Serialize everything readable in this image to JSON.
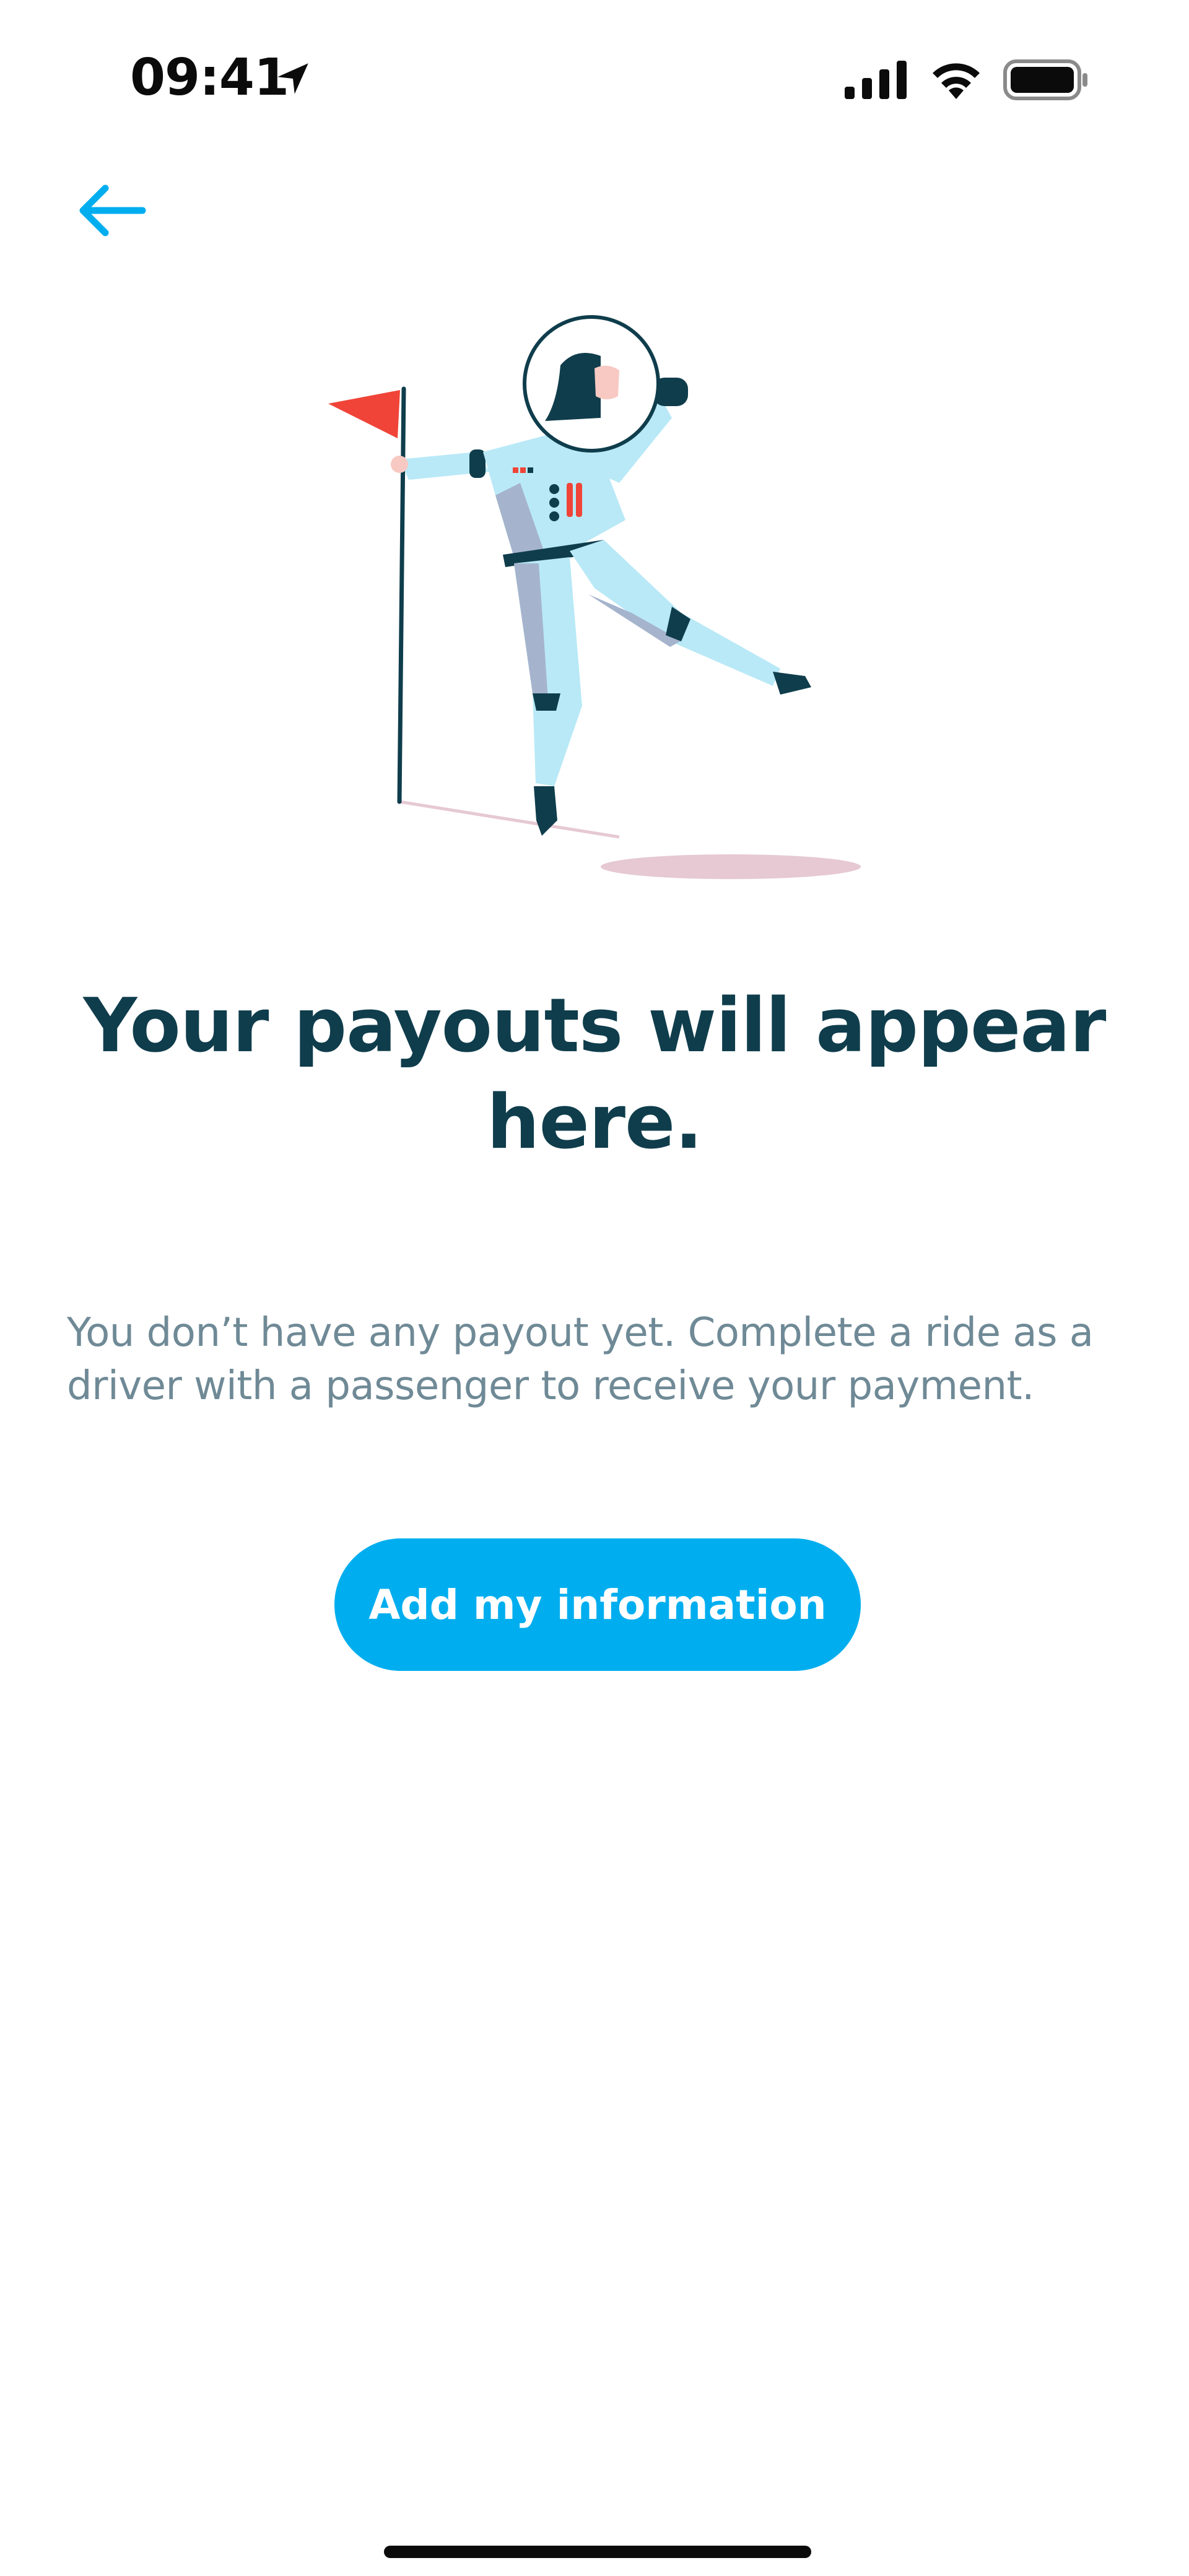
{
  "status_bar": {
    "time": "09:41",
    "icons": [
      "location-arrow-icon",
      "cellular-signal-icon",
      "wifi-icon",
      "battery-icon"
    ]
  },
  "navigation": {
    "back_icon": "arrow-left-icon"
  },
  "illustration": {
    "subject": "astronaut-with-flag"
  },
  "empty_state": {
    "title": "Your payouts will appear here.",
    "description": "You don’t have any payout yet. Complete a ride as a driver with a passenger to receive your payment.",
    "cta_label": "Add my information"
  },
  "colors": {
    "accent": "#00aeef",
    "title": "#0f3d4c",
    "body_text": "#6f8a96",
    "flag": "#f04438"
  }
}
